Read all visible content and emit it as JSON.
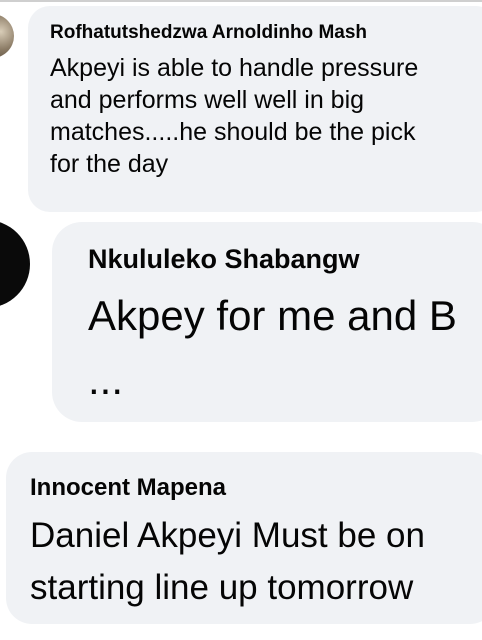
{
  "comments": [
    {
      "author": "Rofhatutshedzwa Arnoldinho Mash",
      "text": "Akpeyi is able to handle pressure\nand performs well well in big\nmatches.....he should be the pick\nfor the day"
    },
    {
      "author": "Nkululeko Shabangw",
      "text": "Akpey for me and B\n..."
    },
    {
      "author": "Innocent Mapena",
      "text": "Daniel Akpeyi Must be on\nstarting line up tomorrow"
    }
  ],
  "colors": {
    "bubble_background": "#f0f2f5",
    "text": "#050505",
    "page_background": "#ffffff"
  }
}
